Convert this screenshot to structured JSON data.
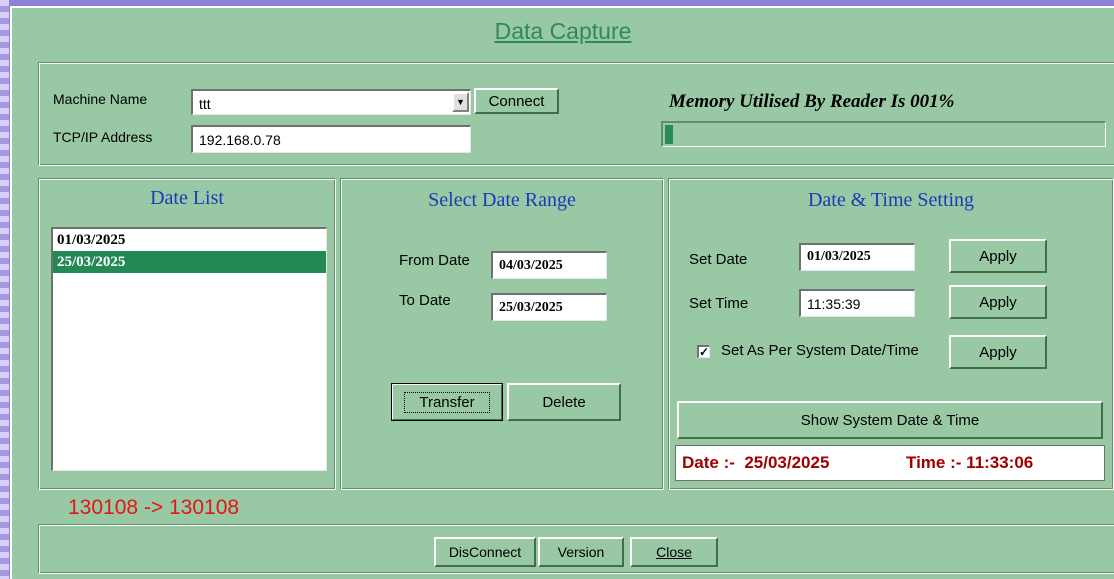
{
  "window": {
    "title": "Data Capture"
  },
  "connection": {
    "machine_name_label": "Machine Name",
    "machine_name_value": "ttt",
    "connect_label": "Connect",
    "tcp_label": "TCP/IP Address",
    "tcp_value": "192.168.0.78"
  },
  "memory": {
    "text": "Memory Utilised By Reader Is 001%",
    "percent": 1
  },
  "date_list": {
    "heading": "Date List",
    "items": [
      "01/03/2025",
      "25/03/2025"
    ],
    "selected_index": 1
  },
  "date_range": {
    "heading": "Select Date Range",
    "from_label": "From Date",
    "from_value": "04/03/2025",
    "to_label": "To Date",
    "to_value": "25/03/2025",
    "transfer_label": "Transfer",
    "delete_label": "Delete"
  },
  "datetime_setting": {
    "heading": "Date & Time Setting",
    "set_date_label": "Set Date",
    "set_date_value": "01/03/2025",
    "set_time_label": "Set Time",
    "set_time_value": "11:35:39",
    "apply_label": "Apply",
    "system_checkbox_label": "Set As Per System Date/Time",
    "system_checkbox_checked": true,
    "show_system_label": "Show System Date & Time",
    "date_display": "Date :-  25/03/2025",
    "time_display": "Time :- 11:33:06"
  },
  "status": {
    "counter": "130108 -> 130108"
  },
  "footer": {
    "disconnect_label": "DisConnect",
    "version_label": "Version",
    "close_label": "Close"
  },
  "colors": {
    "panel_bg": "#98c8a4",
    "selection": "#238a56",
    "heading_blue": "#1f3ab8",
    "counter_red": "#e01818",
    "datetime_red": "#a00000"
  }
}
